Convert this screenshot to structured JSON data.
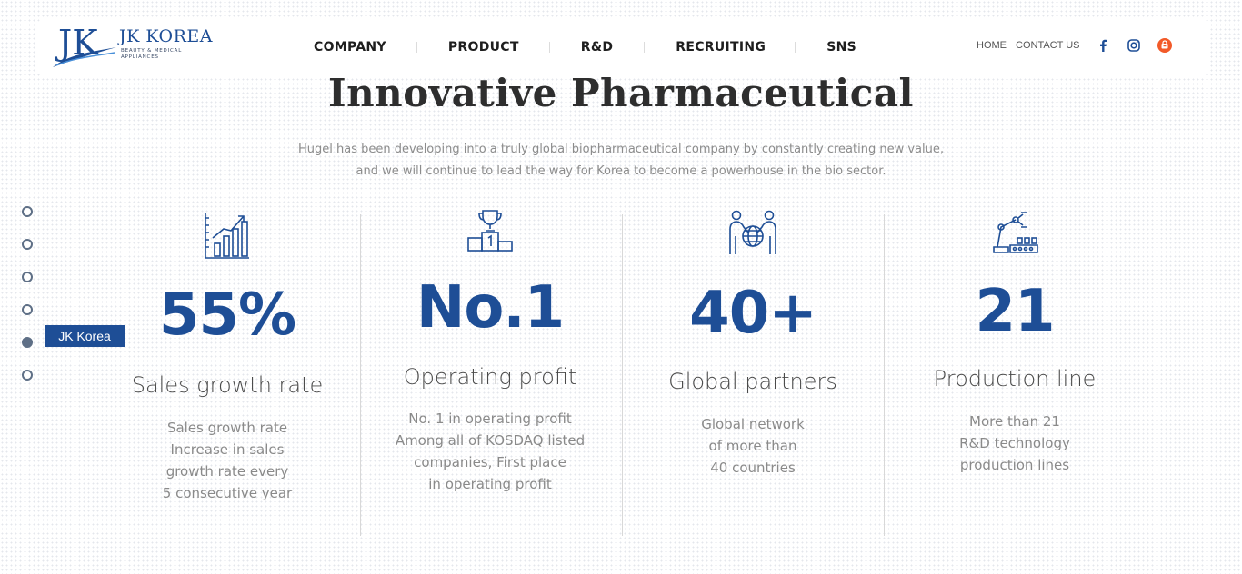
{
  "brand": {
    "logo_initials": "JK",
    "name": "JK KOREA",
    "tagline": "BEAUTY & MEDICAL APPLIANCES",
    "color": "#1e4e96"
  },
  "nav": {
    "items": [
      {
        "label": "COMPANY"
      },
      {
        "label": "PRODUCT"
      },
      {
        "label": "R&D"
      },
      {
        "label": "RECRUITING"
      },
      {
        "label": "SNS"
      }
    ]
  },
  "utility_nav": {
    "home": "HOME",
    "contact": "CONTACT US",
    "icons": [
      "facebook-icon",
      "instagram-icon",
      "shop-icon"
    ]
  },
  "hero": {
    "title": "Innovative Pharmaceutical",
    "desc_line1": "Hugel has been developing into a truly global biopharmaceutical company by constantly creating new value,",
    "desc_line2": "and we will continue to lead the way for Korea to become a powerhouse in the bio sector."
  },
  "section_nav": {
    "active_index": 4,
    "label": "JK Korea"
  },
  "stats": [
    {
      "icon": "growth-chart-icon",
      "value": "55%",
      "label": "Sales growth rate",
      "desc": [
        "Sales growth rate",
        "Increase in sales",
        "growth rate every",
        "5 consecutive year"
      ]
    },
    {
      "icon": "trophy-podium-icon",
      "value": "No.1",
      "label": "Operating profit",
      "desc": [
        "No. 1 in operating profit",
        "Among all of KOSDAQ listed",
        "companies, First place",
        "in operating profit"
      ]
    },
    {
      "icon": "global-partners-icon",
      "value": "40+",
      "label": "Global partners",
      "desc": [
        "Global network",
        "of more than",
        "40 countries"
      ]
    },
    {
      "icon": "production-line-icon",
      "value": "21",
      "label": "Production line",
      "desc": [
        "More than 21",
        "R&D technology",
        "production lines"
      ]
    }
  ],
  "colors": {
    "accent": "#1e4e96",
    "text_dark": "#2e2e2e",
    "text_muted": "#8c8c8c",
    "dot": "#5e6f86",
    "instagram": "#1e4e96",
    "shop": "#f25a29"
  }
}
